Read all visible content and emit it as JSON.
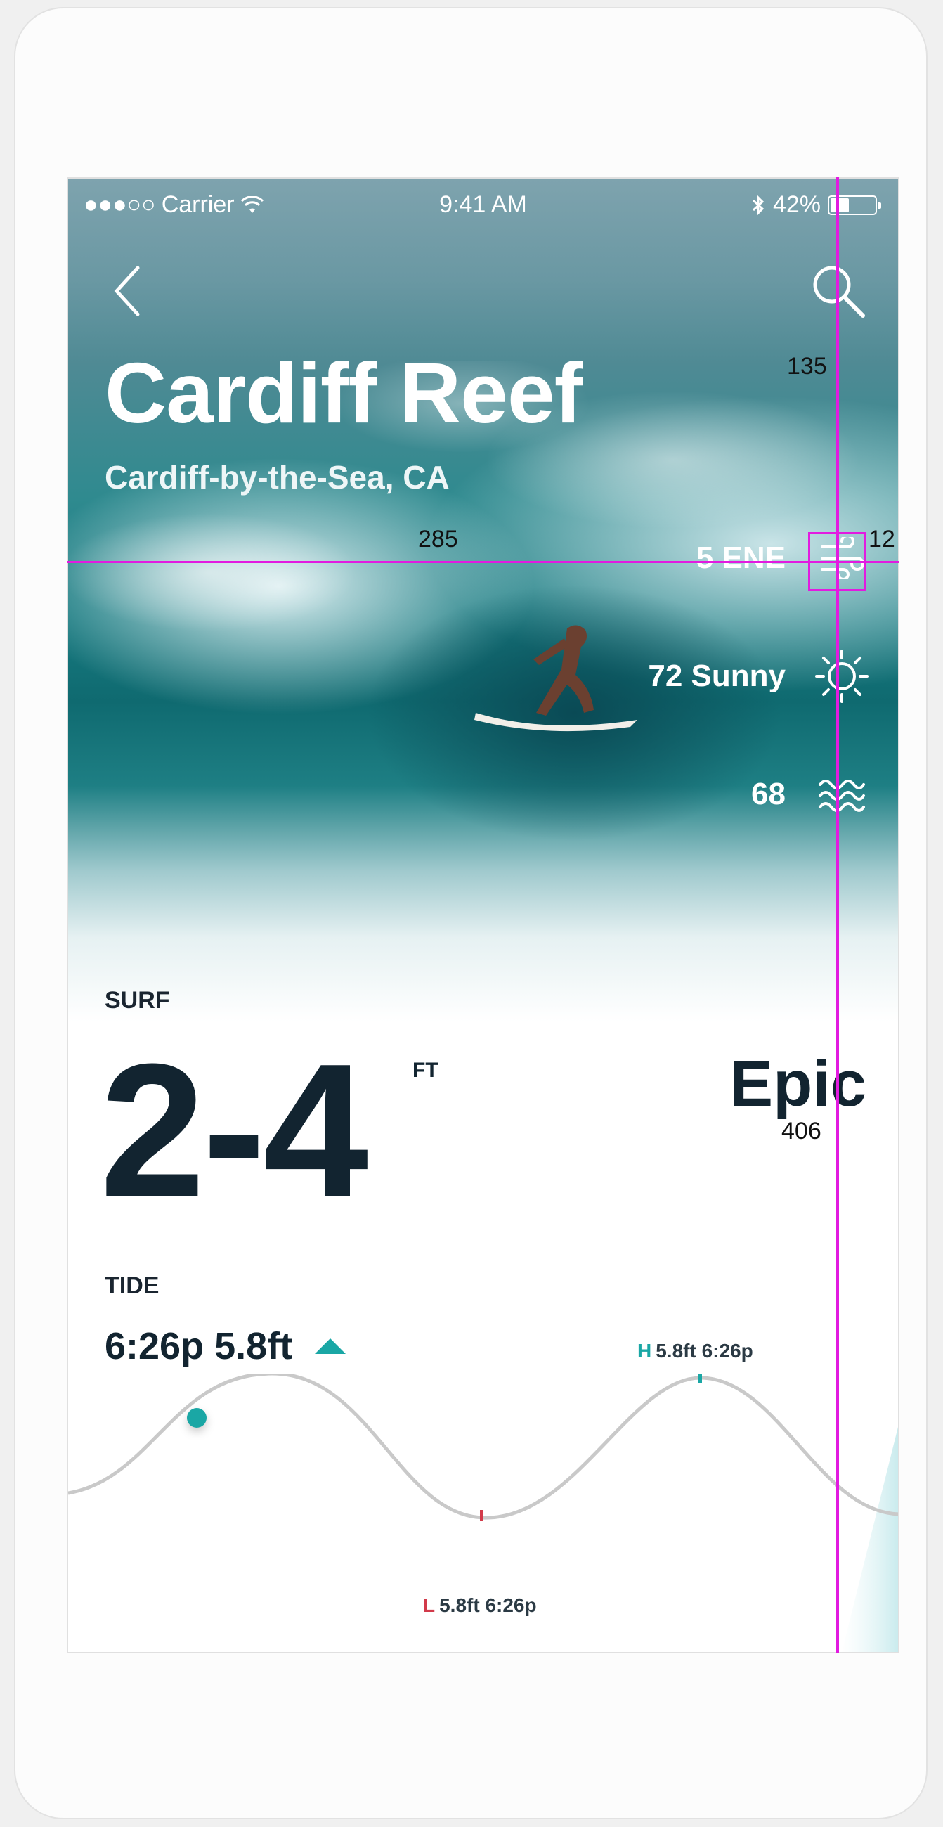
{
  "status_bar": {
    "signal": "●●●○○",
    "carrier": "Carrier",
    "time": "9:41 AM",
    "battery": "42%",
    "battery_level": 0.42
  },
  "header": {
    "title": "Cardiff Reef",
    "subtitle": "Cardiff-by-the-Sea, CA"
  },
  "conditions": [
    {
      "label": "5 ENE",
      "icon": "wind-icon"
    },
    {
      "label": "72 Sunny",
      "icon": "sun-icon"
    },
    {
      "label": "68",
      "icon": "water-temp-icon"
    }
  ],
  "surf": {
    "label": "SURF",
    "height": "2-4",
    "unit": "FT",
    "rating": "Epic"
  },
  "tide": {
    "label": "TIDE",
    "current": "6:26p 5.8ft",
    "high": {
      "marker": "H",
      "text": "5.8ft 6:26p"
    },
    "low": {
      "marker": "L",
      "text": "5.8ft 6:26p"
    }
  },
  "measurements": {
    "a": "135",
    "b": "285",
    "c": "12",
    "d": "406"
  },
  "colors": {
    "accent": "#1aa7a5",
    "low_tide": "#d23a4a",
    "text_dark": "#122430",
    "guide": "#e21be0"
  }
}
